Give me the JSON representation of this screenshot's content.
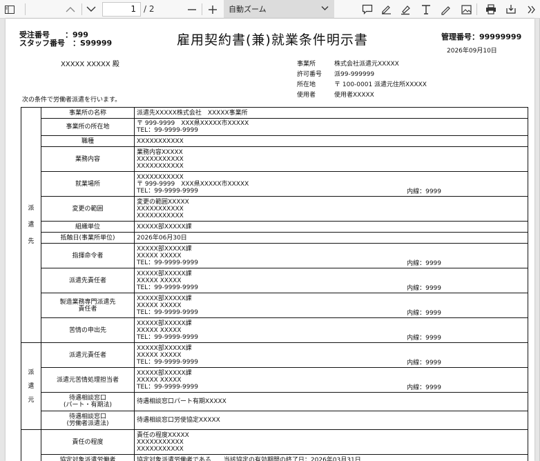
{
  "toolbar": {
    "page_current": "1",
    "page_total": "/ 2",
    "zoom_label": "自動ズーム",
    "icons": [
      "sidebar-toggle-icon",
      "chevron-up-icon",
      "chevron-down-icon",
      "minus-icon",
      "plus-icon",
      "comment-icon",
      "signature-icon",
      "highlight-icon",
      "text-icon",
      "draw-icon",
      "image-icon",
      "print-icon",
      "save-icon",
      "more-icon"
    ]
  },
  "doc": {
    "order_label": "受注番号",
    "order_value": "：999",
    "staff_label": "スタッフ番号",
    "staff_value": "：S99999",
    "title": "雇用契約書(兼)就業条件明示書",
    "mgmt_label": "管理番号：99999999",
    "date": "2026年09月10日",
    "recipient": "XXXXX XXXXX 殿",
    "office_label": "事業所",
    "office_value": "株式会社派遣元XXXXX",
    "permit_label": "許可番号",
    "permit_value": "派99-999999",
    "addr_label": "所在地",
    "addr_value": "〒 100-0001 派遣元住所XXXXX",
    "user_label": "使用者",
    "user_value": "使用者XXXXX",
    "intro": "次の条件で労働者派遣を行います。"
  },
  "table": {
    "side1": [
      "派",
      "遣",
      "先"
    ],
    "side2": [
      "派",
      "遣",
      "元"
    ],
    "rows": [
      {
        "label": [
          "事業所の名称"
        ],
        "lines": [
          "派遣先XXXXX株式会社　XXXXX事業所"
        ],
        "ext": ""
      },
      {
        "label": [
          "事業所の所在地"
        ],
        "lines": [
          "〒 999-9999　XXX県XXXXX市XXXXX",
          "TEL：99-9999-9999"
        ],
        "ext": ""
      },
      {
        "label": [
          "職種"
        ],
        "lines": [
          "XXXXXXXXXXX"
        ],
        "ext": ""
      },
      {
        "label": [
          "業務内容"
        ],
        "lines": [
          "業務内容XXXXX",
          "XXXXXXXXXXX",
          "XXXXXXXXXXX"
        ],
        "ext": ""
      },
      {
        "label": [
          "就業場所"
        ],
        "lines": [
          "XXXXXXXXXXX",
          "〒 999-9999　XXX県XXXXX市XXXXX",
          "TEL：99-9999-9999"
        ],
        "ext": "内線：9999"
      },
      {
        "label": [
          "変更の範囲"
        ],
        "lines": [
          "変更の範囲XXXXX",
          "XXXXXXXXXXX",
          "XXXXXXXXXXX"
        ],
        "ext": ""
      },
      {
        "label": [
          "組織単位"
        ],
        "lines": [
          "XXXXX部XXXXX課"
        ],
        "ext": ""
      },
      {
        "label": [
          "抵触日(事業所単位)"
        ],
        "lines": [
          "2026年06月30日"
        ],
        "ext": ""
      },
      {
        "label": [
          "指揮命令者"
        ],
        "lines": [
          "XXXXX部XXXXX課",
          "XXXXX XXXXX",
          "TEL：99-9999-9999"
        ],
        "ext": "内線：9999"
      },
      {
        "label": [
          "派遣先責任者"
        ],
        "lines": [
          "XXXXX部XXXXX課",
          "XXXXX XXXXX",
          "TEL：99-9999-9999"
        ],
        "ext": "内線：9999"
      },
      {
        "label": [
          "製造業務専門派遣先",
          "責任者"
        ],
        "lines": [
          "XXXXX部XXXXX課",
          "XXXXX XXXXX",
          "TEL：99-9999-9999"
        ],
        "ext": "内線：9999"
      },
      {
        "label": [
          "苦情の申出先"
        ],
        "lines": [
          "XXXXX部XXXXX課",
          "XXXXX XXXXX",
          "TEL：99-9999-9999"
        ],
        "ext": "内線：9999"
      },
      {
        "label": [
          "派遣元責任者"
        ],
        "lines": [
          "XXXXX部XXXXX課",
          "XXXXX XXXXX",
          "TEL：99-9999-9999"
        ],
        "ext": "内線：9999"
      },
      {
        "label": [
          "派遣元苦情処理担当者"
        ],
        "lines": [
          "XXXXX部XXXXX課",
          "XXXXX XXXXX",
          "TEL：99-9999-9999"
        ],
        "ext": "内線：9999"
      },
      {
        "label": [
          "待遇相談窓口",
          "(パート・有期法)"
        ],
        "lines": [
          "待遇相談窓口パート有期XXXXX"
        ],
        "ext": ""
      },
      {
        "label": [
          "待遇相談窓口",
          "(労働者派遣法)"
        ],
        "lines": [
          "待遇相談窓口労使協定XXXXX"
        ],
        "ext": ""
      },
      {
        "label": [
          "責任の程度"
        ],
        "lines": [
          "責任の程度XXXXX",
          "XXXXXXXXXXX",
          "XXXXXXXXXXX"
        ],
        "ext": ""
      },
      {
        "label": [
          "協定対象派遣労働者"
        ],
        "lines": [
          "協定対象派遣労働者である　　当該協定の有効期間の終了日：2026年03月31日"
        ],
        "ext": ""
      }
    ]
  }
}
